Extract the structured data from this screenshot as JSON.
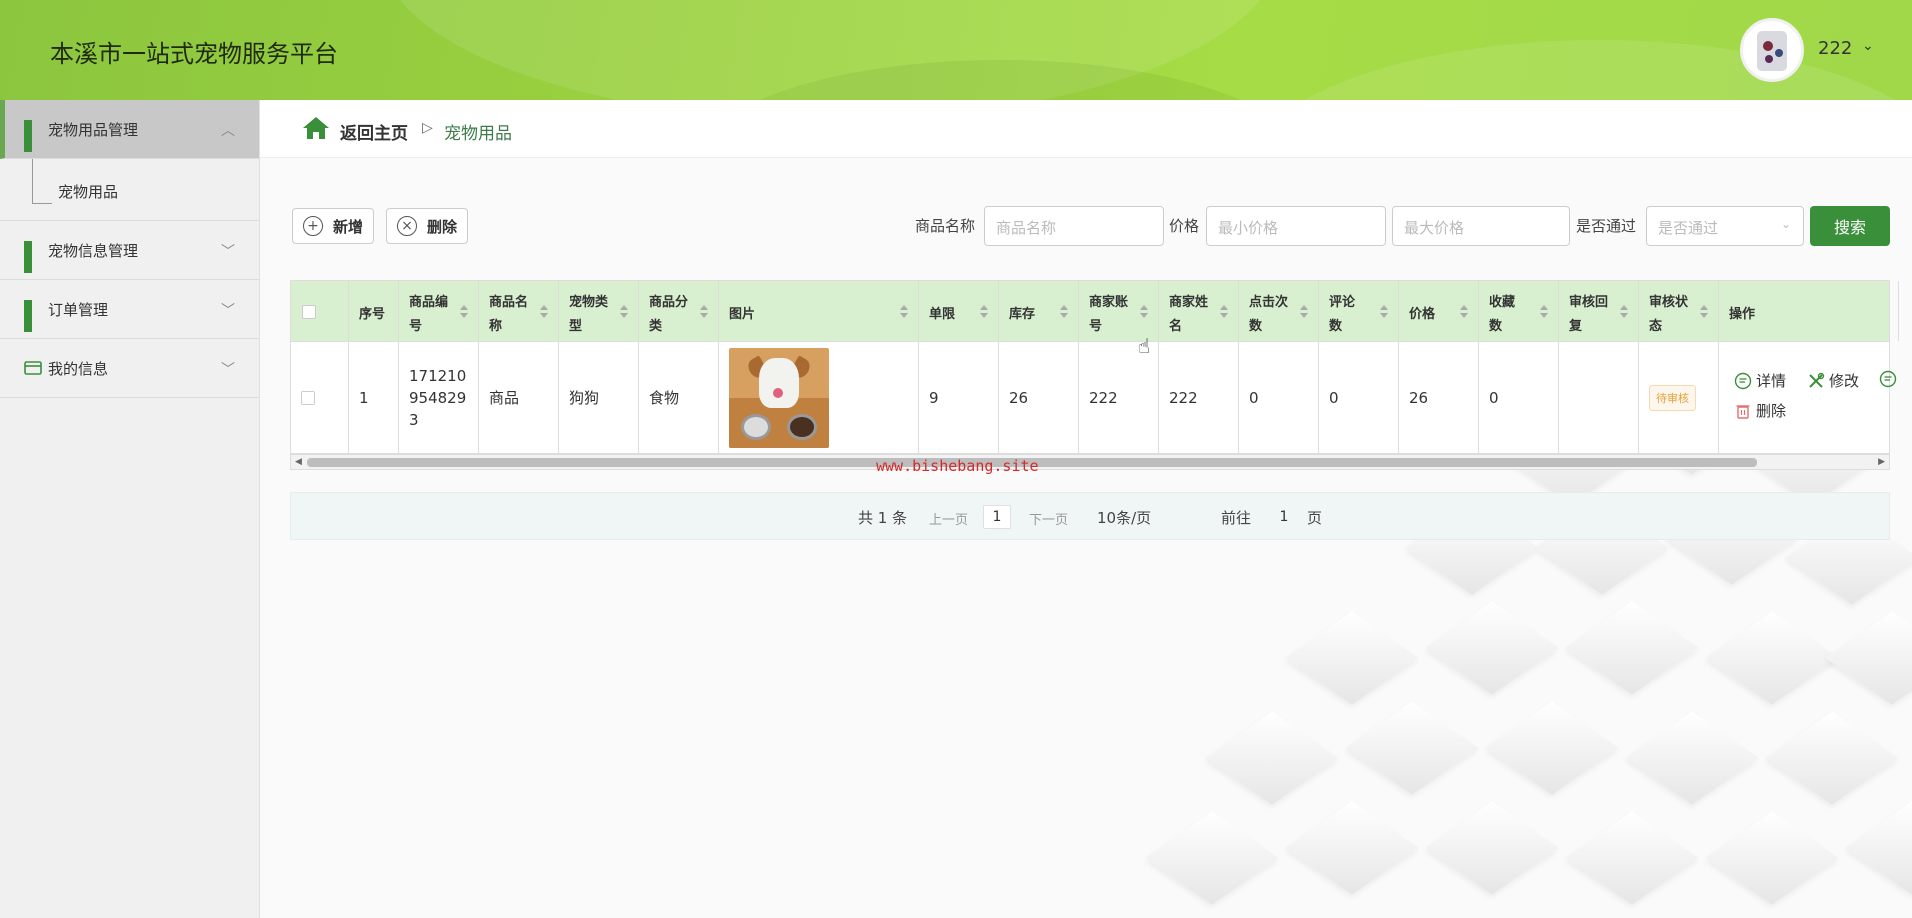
{
  "header": {
    "title": "本溪市一站式宠物服务平台",
    "username": "222",
    "user_caret": "⌄"
  },
  "sidebar": {
    "items": [
      {
        "label": "宠物用品管理",
        "icon": "grid-icon",
        "chevron": "︿"
      },
      {
        "label": "宠物用品"
      },
      {
        "label": "宠物信息管理",
        "icon": "grid-icon",
        "chevron": "﹀"
      },
      {
        "label": "订单管理",
        "icon": "grid-icon",
        "chevron": "﹀"
      },
      {
        "label": "我的信息",
        "icon": "card-icon",
        "chevron": "﹀"
      }
    ]
  },
  "breadcrumb": {
    "home": "返回主页",
    "sep": "▷",
    "current": "宠物用品"
  },
  "toolbar": {
    "add_label": "新增",
    "delete_label": "删除",
    "filters": [
      {
        "label": "商品名称",
        "placeholder": "商品名称"
      },
      {
        "label": "价格",
        "placeholder": "最小价格"
      },
      {
        "label": "",
        "placeholder": "最大价格"
      },
      {
        "label": "是否通过",
        "placeholder": "是否通过"
      }
    ],
    "search_label": "搜索"
  },
  "table": {
    "headers": [
      "序号",
      "商品编号",
      "商品名称",
      "宠物类型",
      "商品分类",
      "图片",
      "单限",
      "库存",
      "商家账号",
      "商家姓名",
      "点击次数",
      "评论数",
      "价格",
      "收藏数",
      "审核回复",
      "审核状态",
      "操作"
    ],
    "header_lines": [
      [
        "序号"
      ],
      [
        "商品编",
        "号"
      ],
      [
        "商品名",
        "称"
      ],
      [
        "宠物类",
        "型"
      ],
      [
        "商品分",
        "类"
      ],
      [
        "图片"
      ],
      [
        "单限"
      ],
      [
        "库存"
      ],
      [
        "商家账",
        "号"
      ],
      [
        "商家姓",
        "名"
      ],
      [
        "点击次",
        "数"
      ],
      [
        "评论",
        "数"
      ],
      [
        "价格"
      ],
      [
        "收藏",
        "数"
      ],
      [
        "审核回",
        "复"
      ],
      [
        "审核状",
        "态"
      ],
      [
        "操作"
      ]
    ],
    "rows": [
      {
        "index": "1",
        "code_lines": [
          "171210",
          "954829",
          "3"
        ],
        "name": "商品",
        "pet_type": "狗狗",
        "category": "食物",
        "limit": "9",
        "stock": "26",
        "merchant_account": "222",
        "merchant_name": "222",
        "clicks": "0",
        "comments": "0",
        "price": "26",
        "favorites": "0",
        "review_reply": "",
        "status": "待审核",
        "ops": {
          "detail": "详情",
          "edit": "修改",
          "delete": "删除"
        }
      }
    ]
  },
  "watermark": "www.bishebang.site",
  "pager": {
    "total": "共 1 条",
    "prev": "上一页",
    "page": "1",
    "next": "下一页",
    "size": "10条/页",
    "goto": "前往",
    "goto_value": "1",
    "page_unit": "页"
  },
  "colors": {
    "header_green": "#9ad13f",
    "accent": "#3a8f3a",
    "table_header": "#d8f0d0",
    "status_pending": "#e6a23c",
    "watermark": "#d42a2a"
  }
}
